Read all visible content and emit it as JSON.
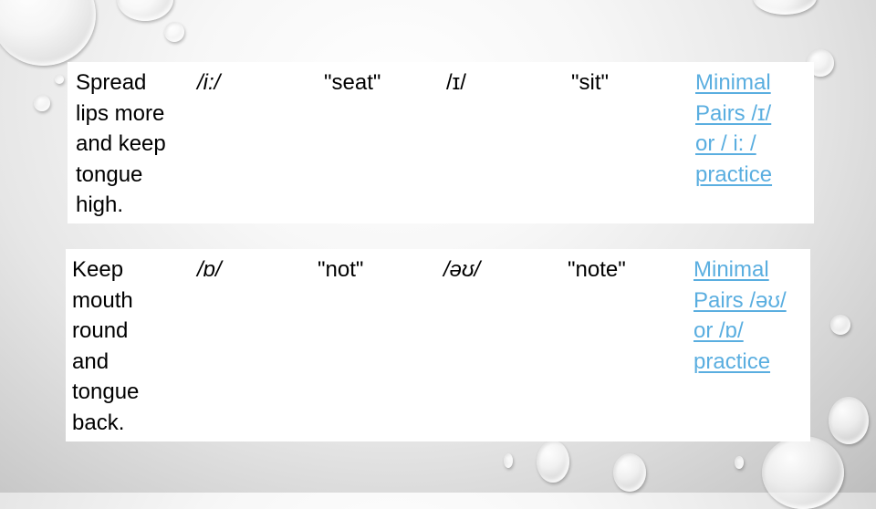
{
  "slide": {
    "rows": [
      {
        "description": "Spread\nlips more\nand keep\ntongue\nhigh.",
        "sound_a": "/i:/",
        "word_a": "\"seat\"",
        "sound_b": "/ɪ/",
        "word_b": "\"sit\"",
        "link_lines": [
          "Minimal",
          "Pairs /ɪ/",
          "or / i: /",
          "practice"
        ]
      },
      {
        "description": "Keep\nmouth\nround\nand\ntongue\nback.",
        "sound_a": "/ɒ/",
        "word_a": "\"not\"",
        "sound_b": "/əʊ/",
        "word_b": "\"note\"",
        "link_lines": [
          "Minimal",
          "Pairs /əʊ/",
          "or /ɒ/",
          "practice"
        ]
      }
    ]
  },
  "colors": {
    "link": "#5aaee0",
    "text": "#000000",
    "panel": "#ffffff"
  }
}
